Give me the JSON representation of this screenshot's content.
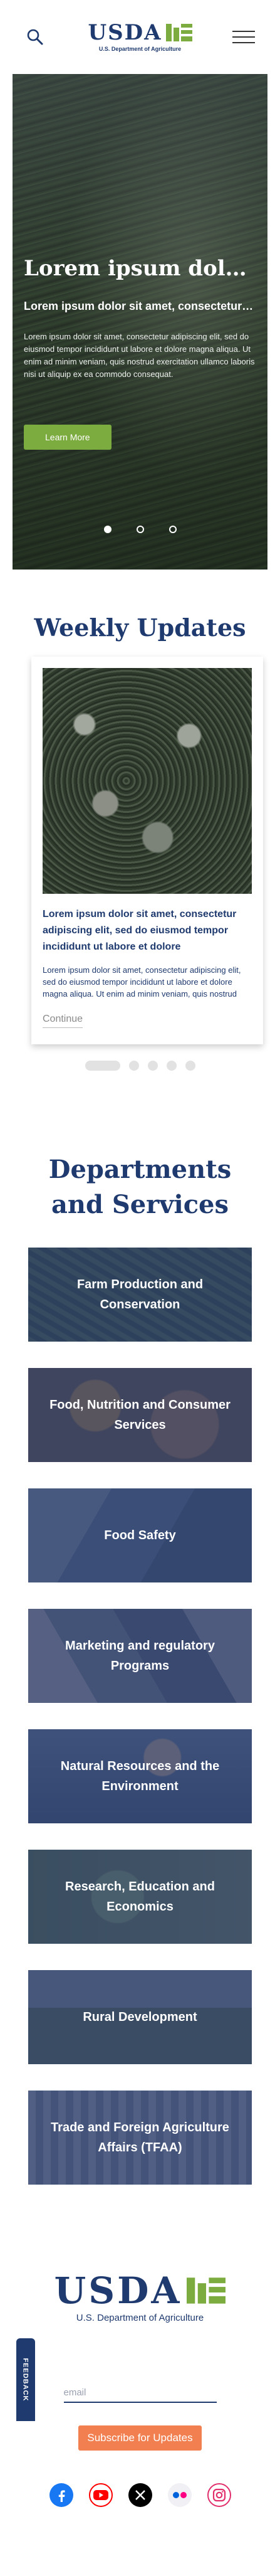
{
  "header": {
    "logo_text": "USDA",
    "logo_subtitle": "U.S. Department of Agriculture",
    "logo_color": "#1f3a6e",
    "logo_accent": "#7cab3f",
    "search_icon": "search-icon",
    "menu_icon": "hamburger-menu-icon"
  },
  "hero": {
    "title": "Lorem ipsum dolor sit amet",
    "subtitle": "Lorem ipsum dolor sit amet, consectetur adipiscing elit",
    "body": "Lorem ipsum dolor sit amet, consectetur adipiscing elit, sed do eiusmod tempor incididunt ut labore et dolore magna aliqua. Ut enim ad minim veniam, quis nostrud exercitation ullamco laboris nisi ut aliquip ex ea commodo consequat.",
    "button_label": "Learn More",
    "button_color": "#7cab3f",
    "slides": 3,
    "active_slide": 1
  },
  "updates": {
    "title": "Weekly Updates",
    "card": {
      "title": "Lorem ipsum dolor sit amet, consectetur adipiscing elit, sed do eiusmod tempor incididunt ut labore et dolore",
      "body": "Lorem ipsum dolor sit amet, consectetur adipiscing elit, sed do eiusmod tempor incididunt ut labore et dolore magna aliqua. Ut enim ad minim veniam, quis nostrud exercitation.",
      "link_label": "Continue"
    },
    "pages": 5,
    "active_page": 1
  },
  "departments": {
    "title": "Departments and Services",
    "items": [
      {
        "label": "Farm Production and Conservation"
      },
      {
        "label": "Food, Nutrition and Consumer Services"
      },
      {
        "label": "Food Safety"
      },
      {
        "label": "Marketing and regulatory Programs"
      },
      {
        "label": "Natural Resources and the Environment"
      },
      {
        "label": "Research, Education and Economics"
      },
      {
        "label": "Rural Development"
      },
      {
        "label": "Trade and Foreign Agriculture Affairs (TFAA)"
      }
    ]
  },
  "footer": {
    "logo_text": "USDA",
    "logo_subtitle": "U.S. Department of Agriculture",
    "email_placeholder": "email",
    "subscribe_label": "Subscribe for Updates",
    "subscribe_color": "#f27f50",
    "social": [
      {
        "name": "facebook-icon",
        "color": "#1877f2"
      },
      {
        "name": "youtube-icon",
        "color": "#ff0000"
      },
      {
        "name": "x-icon",
        "color": "#000000"
      },
      {
        "name": "flickr-icon",
        "color": "#ff0084"
      },
      {
        "name": "instagram-icon",
        "color": "#e1306c"
      }
    ]
  },
  "feedback": {
    "label": "FEEDBACK"
  }
}
